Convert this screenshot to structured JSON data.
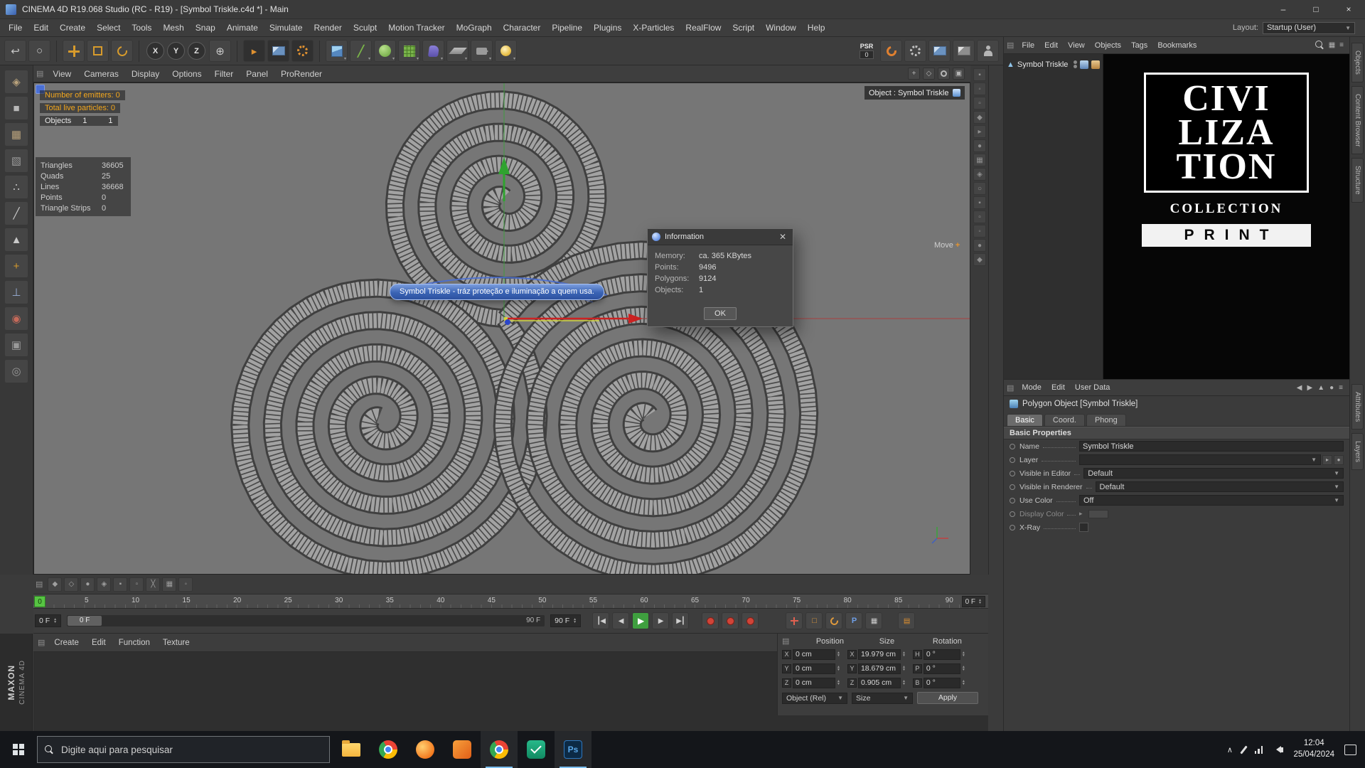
{
  "window": {
    "title": "CINEMA 4D R19.068 Studio (RC - R19) - [Symbol Triskle.c4d *] - Main"
  },
  "menu_bar": {
    "items": [
      "File",
      "Edit",
      "Create",
      "Select",
      "Tools",
      "Mesh",
      "Snap",
      "Animate",
      "Simulate",
      "Render",
      "Sculpt",
      "Motion Tracker",
      "MoGraph",
      "Character",
      "Pipeline",
      "Plugins",
      "X-Particles",
      "RealFlow",
      "Script",
      "Window",
      "Help"
    ],
    "layout_label": "Layout:",
    "layout_value": "Startup (User)"
  },
  "toolbar": {
    "axis": [
      "X",
      "Y",
      "Z"
    ],
    "psr_label": "PSR",
    "psr_value": "0"
  },
  "viewport": {
    "menu": [
      "View",
      "Cameras",
      "Display",
      "Options",
      "Filter",
      "Panel",
      "ProRender"
    ],
    "badge": "Object : Symbol Triskle",
    "move_label": "Move",
    "move_plus": "+",
    "tooltip": "Symbol Triskle - tráz proteção e iluminação a quem usa.",
    "hud": {
      "line1": "Number of emitters: 0",
      "line2": "Total live particles: 0",
      "objects_label": "Objects",
      "objects_v1": "1",
      "objects_v2": "1",
      "stats": [
        {
          "k": "Triangles",
          "v": "36605"
        },
        {
          "k": "Quads",
          "v": "25"
        },
        {
          "k": "Lines",
          "v": "36668"
        },
        {
          "k": "Points",
          "v": "0"
        },
        {
          "k": "Triangle Strips",
          "v": "0"
        }
      ]
    }
  },
  "dialog": {
    "title": "Information",
    "rows": [
      {
        "k": "Memory:",
        "v": "ca. 365 KBytes"
      },
      {
        "k": "Points:",
        "v": "9496"
      },
      {
        "k": "Polygons:",
        "v": "9124"
      },
      {
        "k": "Objects:",
        "v": "1"
      }
    ],
    "ok_label": "OK"
  },
  "object_manager": {
    "menu": [
      "File",
      "Edit",
      "View",
      "Objects",
      "Tags",
      "Bookmarks"
    ],
    "object_name": "Symbol Triskle"
  },
  "picture": {
    "lines": [
      "CIVI",
      "LIZA",
      "TION"
    ],
    "collection_label": "COLLECTION",
    "print_label": "PRINT"
  },
  "attributes": {
    "menu": [
      "Mode",
      "Edit",
      "User Data"
    ],
    "title": "Polygon Object [Symbol Triskle]",
    "tabs": [
      "Basic",
      "Coord.",
      "Phong"
    ],
    "section": "Basic Properties",
    "name_label": "Name",
    "name_value": "Symbol Triskle",
    "layer_label": "Layer",
    "visible_editor_label": "Visible in Editor",
    "visible_editor_value": "Default",
    "visible_renderer_label": "Visible in Renderer",
    "visible_renderer_value": "Default",
    "use_color_label": "Use Color",
    "use_color_value": "Off",
    "display_color_label": "Display Color",
    "xray_label": "X-Ray"
  },
  "timeline": {
    "playhead": "0",
    "ticks": [
      "5",
      "10",
      "15",
      "20",
      "25",
      "30",
      "35",
      "40",
      "45",
      "50",
      "55",
      "60",
      "65",
      "70",
      "75",
      "80",
      "85",
      "90"
    ],
    "mini_frame": "0 F",
    "current_frame": "0 F",
    "slider_thumb": "0 F",
    "slider_end": "90 F",
    "end_frame": "90 F"
  },
  "coordinates": {
    "position_header": "Position",
    "size_header": "Size",
    "rotation_header": "Rotation",
    "rows": [
      {
        "a": "X",
        "pos": "0 cm",
        "sa": "X",
        "size": "19.979 cm",
        "ra": "H",
        "rot": "0 °"
      },
      {
        "a": "Y",
        "pos": "0 cm",
        "sa": "Y",
        "size": "18.679 cm",
        "ra": "P",
        "rot": "0 °"
      },
      {
        "a": "Z",
        "pos": "0 cm",
        "sa": "Z",
        "size": "0.905 cm",
        "ra": "B",
        "rot": "0 °"
      }
    ],
    "object_mode": "Object (Rel)",
    "size_mode": "Size",
    "apply_label": "Apply"
  },
  "material_manager": {
    "menu": [
      "Create",
      "Edit",
      "Function",
      "Texture"
    ]
  },
  "branding": {
    "line1": "MAXON",
    "line2": "CINEMA 4D"
  },
  "side_tabs": {
    "top": [
      "Objects",
      "Content Browser",
      "Structure"
    ],
    "bottom": [
      "Attributes",
      "Layers"
    ]
  },
  "taskbar": {
    "search_placeholder": "Digite aqui para pesquisar",
    "ps_label": "Ps",
    "time": "12:04",
    "date": "25/04/2024"
  }
}
